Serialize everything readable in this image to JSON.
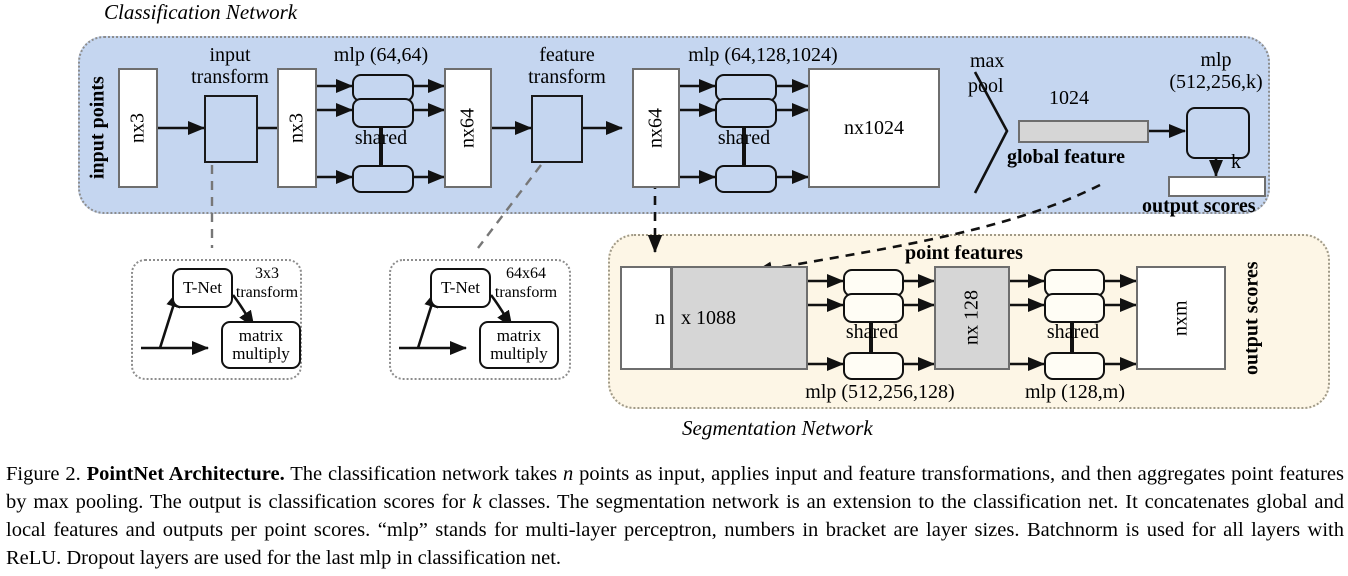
{
  "figure": {
    "classification_title": "Classification Network",
    "segmentation_title": "Segmentation Network"
  },
  "colors": {
    "classification_panel": "#c5d6f0",
    "segmentation_panel": "#fdf6e6",
    "global_feature_bar": "#d6d6d6",
    "point_feature_gray": "#d6d6d6",
    "stroke": "#111111"
  },
  "classification": {
    "side_label": "input points",
    "nx3_in": "nx3",
    "input_transform_label_l1": "input",
    "input_transform_label_l2": "transform",
    "nx3_out": "nx3",
    "mlp1_label": "mlp (64,64)",
    "mlp1_shared": "shared",
    "nx64_a": "nx64",
    "feature_transform_label_l1": "feature",
    "feature_transform_label_l2": "transform",
    "nx64_b": "nx64",
    "mlp2_label": "mlp (64,128,1024)",
    "mlp2_shared": "shared",
    "nx1024": "nx1024",
    "maxpool_l1": "max",
    "maxpool_l2": "pool",
    "global_feature_size": "1024",
    "global_feature_label": "global feature",
    "mlp3_label_l1": "mlp",
    "mlp3_label_l2": "(512,256,k)",
    "k_label": "k",
    "output_scores": "output scores"
  },
  "tnet_input": {
    "tnet": "T-Net",
    "transform_l1": "3x3",
    "transform_l2": "transform",
    "matmul_l1": "matrix",
    "matmul_l2": "multiply"
  },
  "tnet_feature": {
    "tnet": "T-Net",
    "transform_l1": "64x64",
    "transform_l2": "transform",
    "matmul_l1": "matrix",
    "matmul_l2": "multiply"
  },
  "segmentation": {
    "point_features": "point features",
    "concat_n": "n",
    "concat_x1088": "x 1088",
    "mlp4_label": "mlp (512,256,128)",
    "mlp4_shared": "shared",
    "nx128": "nx 128",
    "mlp5_label": "mlp (128,m)",
    "mlp5_shared": "shared",
    "nxm": "nxm",
    "output_scores": "output scores"
  },
  "caption": {
    "prefix": "Figure 2.",
    "title": "PointNet Architecture.",
    "s1a": " The classification network takes ",
    "n1": "n",
    "s1b": " points as input, applies input and feature transformations, and then aggregates point features by max pooling. The output is classification scores for ",
    "k1": "k",
    "s1c": " classes. The segmentation network is an extension to the classification net. It concatenates global and local features and outputs per point scores. “mlp” stands for multi-layer perceptron, numbers in bracket are layer sizes. Batchnorm is used for all layers with ReLU. Dropout layers are used for the last mlp in classification net."
  }
}
